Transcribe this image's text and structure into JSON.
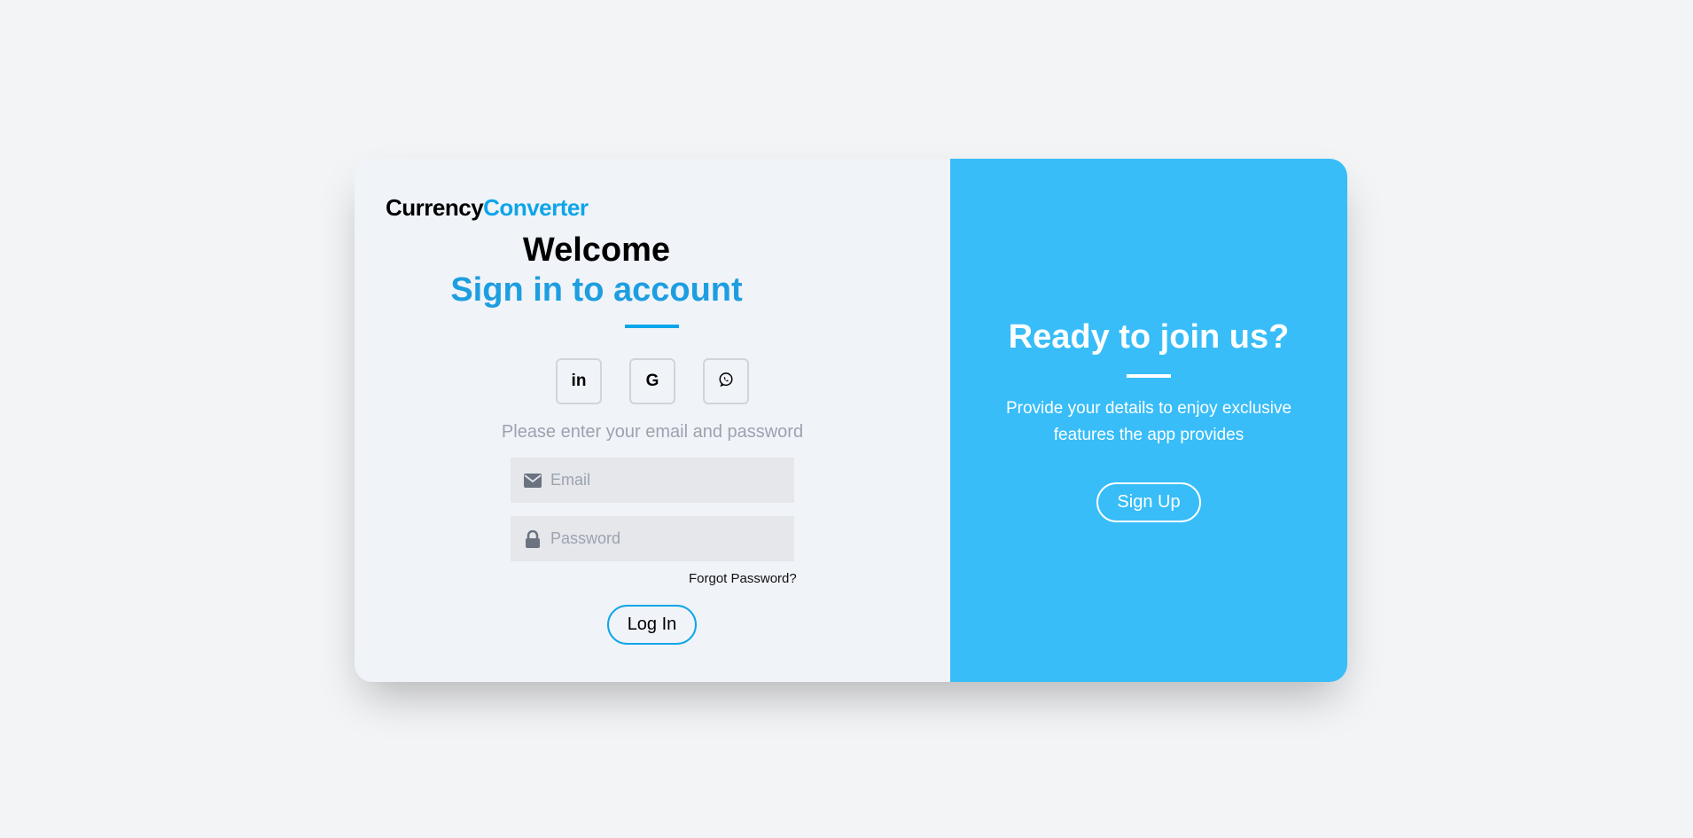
{
  "logo": {
    "part1": "Currency",
    "part2": "Converter"
  },
  "login": {
    "welcome": "Welcome",
    "subtitle": "Sign in to account",
    "socials": [
      {
        "icon": "linkedin-icon",
        "glyph": "in"
      },
      {
        "icon": "google-icon",
        "glyph": "G"
      },
      {
        "icon": "whatsapp-icon",
        "glyph": "✆"
      }
    ],
    "prompt": "Please enter your email and password",
    "email_placeholder": "Email",
    "password_placeholder": "Password",
    "forgot_label": "Forgot Password?",
    "login_label": "Log In"
  },
  "signup_panel": {
    "title": "Ready to join us?",
    "description": "Provide your details to enjoy exclusive features the app provides",
    "signup_label": "Sign Up"
  },
  "colors": {
    "accent": "#0ea5e9",
    "panel": "#38bdf8",
    "left_bg": "#f0f3f8",
    "page_bg": "#f3f4f6"
  }
}
